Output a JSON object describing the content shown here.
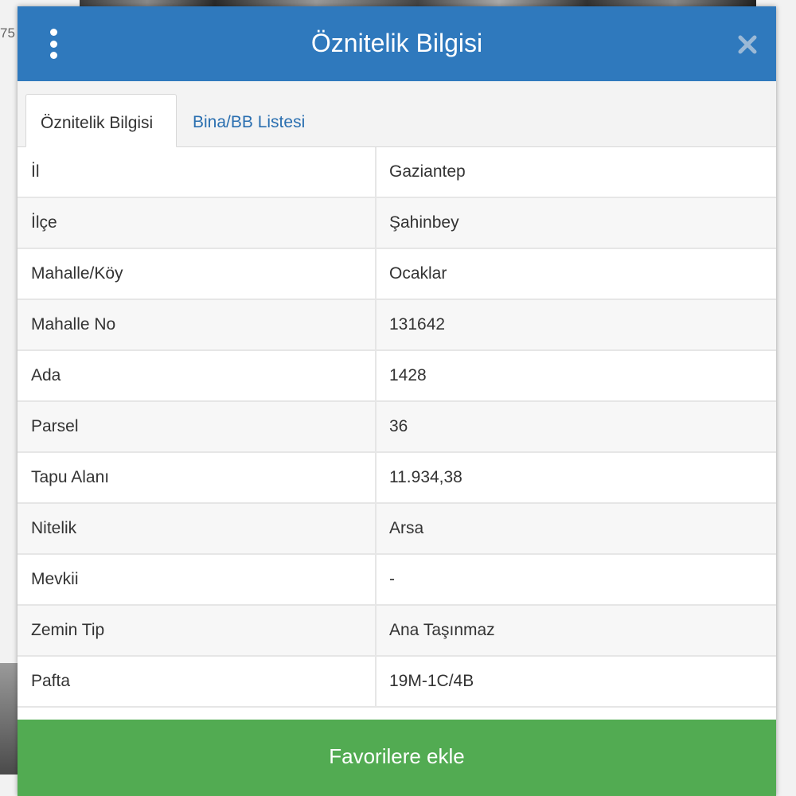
{
  "background": {
    "left_text": "75"
  },
  "dialog": {
    "title": "Öznitelik Bilgisi",
    "menu_icon": "vertical-dots-icon",
    "close_icon": "close-icon"
  },
  "tabs": [
    {
      "label": "Öznitelik Bilgisi",
      "active": true
    },
    {
      "label": "Bina/BB Listesi",
      "active": false
    }
  ],
  "rows": [
    {
      "label": "İl",
      "value": "Gaziantep"
    },
    {
      "label": "İlçe",
      "value": "Şahinbey"
    },
    {
      "label": "Mahalle/Köy",
      "value": "Ocaklar"
    },
    {
      "label": "Mahalle No",
      "value": "131642"
    },
    {
      "label": "Ada",
      "value": "1428"
    },
    {
      "label": "Parsel",
      "value": "36"
    },
    {
      "label": "Tapu Alanı",
      "value": "11.934,38"
    },
    {
      "label": "Nitelik",
      "value": "Arsa"
    },
    {
      "label": "Mevkii",
      "value": "-"
    },
    {
      "label": "Zemin Tip",
      "value": "Ana Taşınmaz"
    },
    {
      "label": "Pafta",
      "value": "19M-1C/4B"
    }
  ],
  "footer": {
    "favorite_label": "Favorilere ekle"
  },
  "colors": {
    "header": "#2f79bd",
    "favorite_button": "#52ab52",
    "tab_link": "#2a6fb0"
  }
}
